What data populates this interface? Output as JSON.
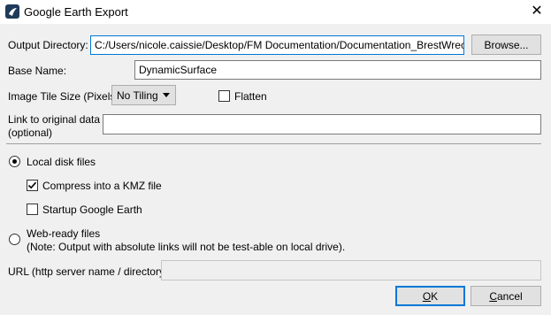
{
  "window": {
    "title": "Google Earth Export",
    "close_glyph": "✕",
    "app_icon": "google-earth-icon"
  },
  "output_directory": {
    "label": "Output Directory:",
    "value": "C:/Users/nicole.caissie/Desktop/FM Documentation/Documentation_BrestWrecks",
    "browse_label": "Browse..."
  },
  "base_name": {
    "label": "Base Name:",
    "value": "DynamicSurface"
  },
  "tile_size": {
    "label": "Image Tile Size (Pixels):",
    "selected": "No Tiling"
  },
  "flatten": {
    "label": "Flatten",
    "checked": false
  },
  "link_original": {
    "label_line1": "Link to original data",
    "label_line2": "(optional)",
    "value": ""
  },
  "local_disk": {
    "label": "Local disk files",
    "selected": true
  },
  "compress_kmz": {
    "label": "Compress into a KMZ file",
    "checked": true
  },
  "startup_ge": {
    "label": "Startup Google Earth",
    "checked": false
  },
  "web_ready": {
    "label": "Web-ready files",
    "note": "(Note: Output with absolute links will not be test-able on local drive).",
    "selected": false
  },
  "url": {
    "label": "URL (http server name / directory):",
    "value": ""
  },
  "buttons": {
    "ok_mnemonic": "O",
    "ok_rest": "K",
    "cancel_mnemonic": "C",
    "cancel_rest": "ancel"
  },
  "colors": {
    "focus_border": "#0078d7",
    "dialog_bg": "#f0f0f0"
  }
}
